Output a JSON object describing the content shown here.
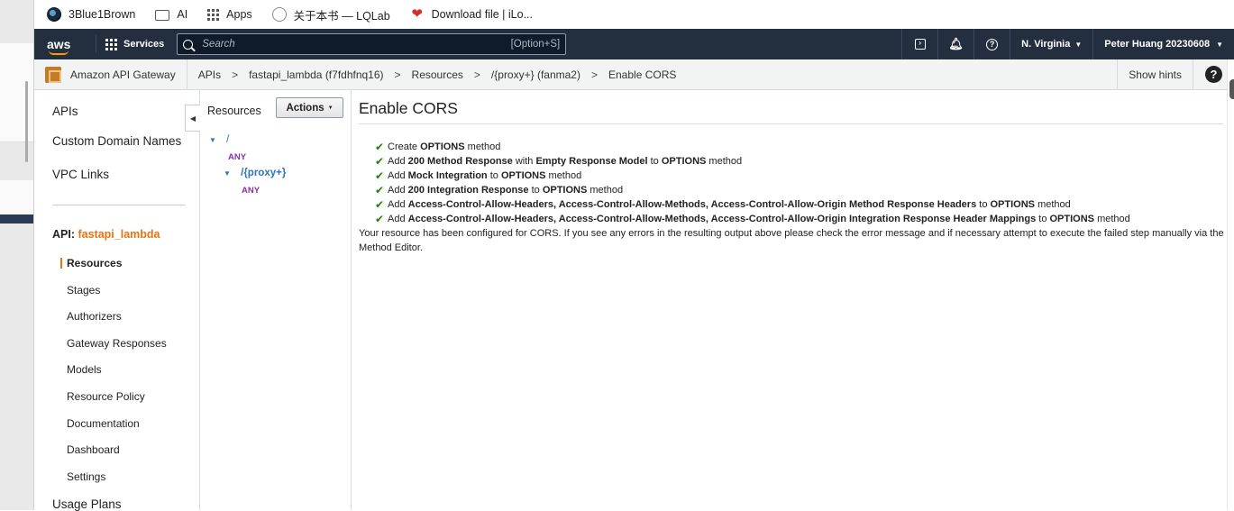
{
  "bookmarks": [
    {
      "label": "3Blue1Brown",
      "icon": "3blue1brown-icon"
    },
    {
      "label": "AI",
      "icon": "folder-icon"
    },
    {
      "label": "Apps",
      "icon": "apps-grid-icon"
    },
    {
      "label": "关于本书 — LQLab",
      "icon": "lqlab-icon"
    },
    {
      "label": "Download file | iLo...",
      "icon": "heart-icon"
    }
  ],
  "topnav": {
    "logo": "aws",
    "services": "Services",
    "search_placeholder": "Search",
    "search_shortcut": "[Option+S]",
    "region": "N. Virginia",
    "account": "Peter Huang 20230608"
  },
  "breadcrumb": {
    "service": "Amazon API Gateway",
    "items": [
      "APIs",
      "fastapi_lambda (f7fdhfnq16)",
      "Resources",
      "/{proxy+} (fanma2)",
      "Enable CORS"
    ],
    "separator": ">",
    "show_hints": "Show hints",
    "help": "?"
  },
  "leftnav": {
    "top_items": [
      "APIs",
      "Custom Domain Names",
      "VPC Links"
    ],
    "api_prefix": "API:",
    "api_name": "fastapi_lambda",
    "sub_items": [
      "Resources",
      "Stages",
      "Authorizers",
      "Gateway Responses",
      "Models",
      "Resource Policy",
      "Documentation",
      "Dashboard",
      "Settings"
    ],
    "bottom_item": "Usage Plans"
  },
  "resources_panel": {
    "title": "Resources",
    "actions_label": "Actions",
    "tree": [
      {
        "path": "/",
        "method": "ANY"
      },
      {
        "path": "/{proxy+}",
        "method": "ANY"
      }
    ]
  },
  "main": {
    "title": "Enable CORS",
    "steps": [
      [
        {
          "t": "Create "
        },
        {
          "t": "OPTIONS",
          "b": true
        },
        {
          "t": " method"
        }
      ],
      [
        {
          "t": "Add "
        },
        {
          "t": "200 Method Response",
          "b": true
        },
        {
          "t": " with "
        },
        {
          "t": "Empty Response Model",
          "b": true
        },
        {
          "t": " to "
        },
        {
          "t": "OPTIONS",
          "b": true
        },
        {
          "t": " method"
        }
      ],
      [
        {
          "t": "Add "
        },
        {
          "t": "Mock Integration",
          "b": true
        },
        {
          "t": " to "
        },
        {
          "t": "OPTIONS",
          "b": true
        },
        {
          "t": " method"
        }
      ],
      [
        {
          "t": "Add "
        },
        {
          "t": "200 Integration Response",
          "b": true
        },
        {
          "t": " to "
        },
        {
          "t": "OPTIONS",
          "b": true
        },
        {
          "t": " method"
        }
      ],
      [
        {
          "t": "Add "
        },
        {
          "t": "Access-Control-Allow-Headers, Access-Control-Allow-Methods, Access-Control-Allow-Origin Method Response Headers",
          "b": true
        },
        {
          "t": " to "
        },
        {
          "t": "OPTIONS",
          "b": true
        },
        {
          "t": " method"
        }
      ],
      [
        {
          "t": "Add "
        },
        {
          "t": "Access-Control-Allow-Headers, Access-Control-Allow-Methods, Access-Control-Allow-Origin Integration Response Header Mappings",
          "b": true
        },
        {
          "t": " to "
        },
        {
          "t": "OPTIONS",
          "b": true
        },
        {
          "t": " method"
        }
      ]
    ],
    "summary": "Your resource has been configured for CORS. If you see any errors in the resulting output above please check the error message and if necessary attempt to execute the failed step manually via the Method Editor."
  },
  "colors": {
    "aws_nav": "#232f3e",
    "accent_orange": "#ec7211",
    "success_green": "#1d8102",
    "link_blue": "#2e73b8",
    "method_purple": "#8c2fa8"
  }
}
